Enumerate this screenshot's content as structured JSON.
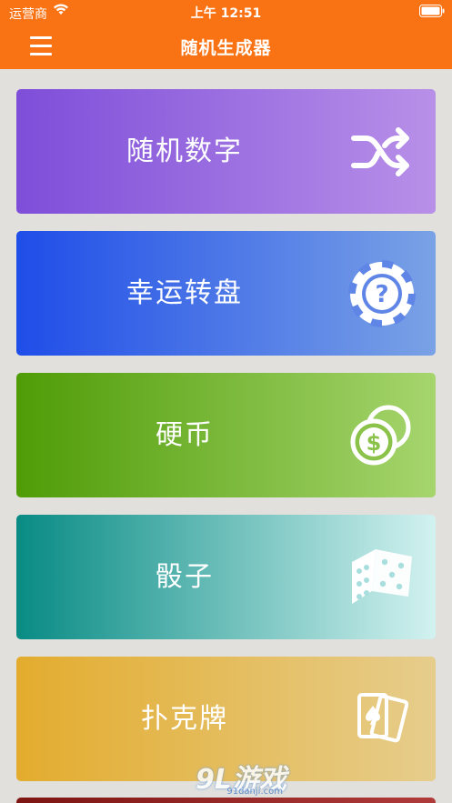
{
  "status_bar": {
    "carrier": "运营商",
    "time": "上午 12:51"
  },
  "nav": {
    "title": "随机生成器"
  },
  "cards": [
    {
      "label": "随机数字",
      "icon": "shuffle-icon"
    },
    {
      "label": "幸运转盘",
      "icon": "roulette-chip-icon"
    },
    {
      "label": "硬币",
      "icon": "coins-icon"
    },
    {
      "label": "骰子",
      "icon": "dice-icon"
    },
    {
      "label": "扑克牌",
      "icon": "playing-cards-icon"
    }
  ],
  "watermark": {
    "text": "9L游戏",
    "url_text": "91danji.com"
  },
  "colors": {
    "accent": "#f97314",
    "background": "#e1e0dc"
  }
}
